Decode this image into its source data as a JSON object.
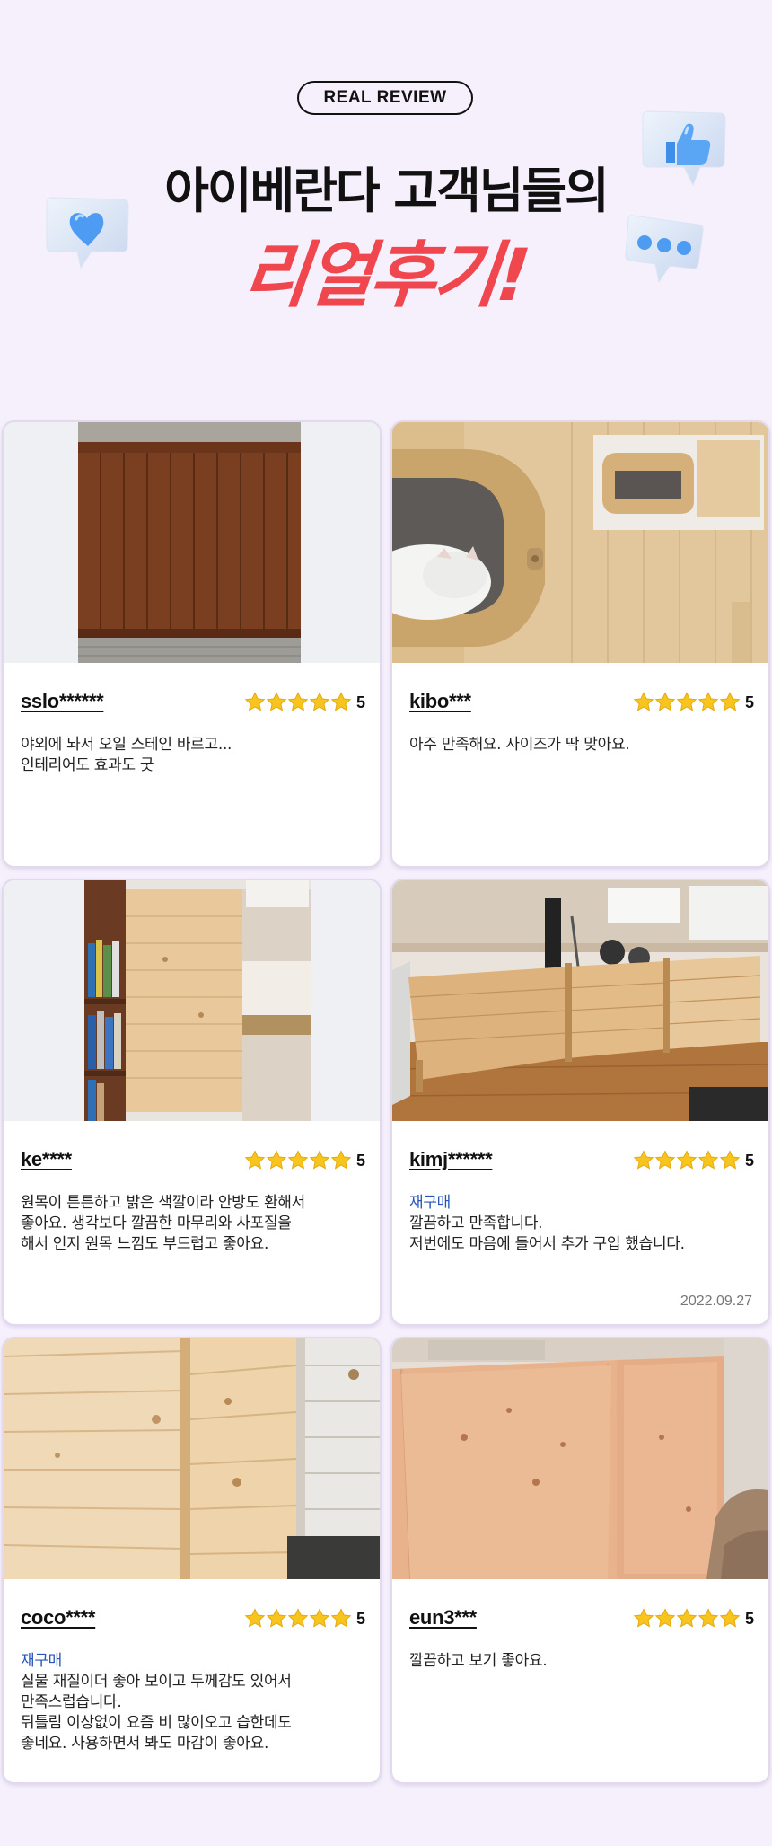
{
  "header": {
    "pill": "REAL REVIEW",
    "title_line1": "아이베란다 고객님들의",
    "title_line2": "리얼후기!",
    "decor_icons": [
      "heart-icon",
      "thumbs-up-icon",
      "chat-dots-icon"
    ]
  },
  "colors": {
    "background": "#f6f0fd",
    "accent_red": "#f0464e",
    "rebuy_blue": "#2a55b8",
    "star": "#f7c51e",
    "icon_blue": "#5aa6f5"
  },
  "reviews": [
    {
      "name": "sslo******",
      "rating": "5",
      "rebuy": "",
      "lines": [
        "야외에 놔서 오일 스테인 바르고...",
        "인테리어도 효과도 굿"
      ],
      "date": ""
    },
    {
      "name": "kibo***",
      "rating": "5",
      "rebuy": "",
      "lines": [
        "아주 만족해요. 사이즈가 딱 맞아요."
      ],
      "date": ""
    },
    {
      "name": "ke****",
      "rating": "5",
      "rebuy": "",
      "lines": [
        "원목이 튼튼하고 밝은 색깔이라 안방도 환해서",
        "좋아요. 생각보다 깔끔한 마무리와 사포질을",
        "해서 인지 원목 느낌도 부드럽고 좋아요."
      ],
      "date": ""
    },
    {
      "name": "kimj******",
      "rating": "5",
      "rebuy": "재구매",
      "lines": [
        "깔끔하고 만족합니다.",
        "저번에도 마음에 들어서 추가 구입 했습니다."
      ],
      "date": "2022.09.27"
    },
    {
      "name": "coco****",
      "rating": "5",
      "rebuy": "재구매",
      "lines": [
        "실물 재질이더 좋아 보이고 두께감도 있어서",
        "만족스럽습니다.",
        "뒤틀림 이상없이 요즘 비 많이오고 습한데도",
        "좋네요. 사용하면서 봐도 마감이 좋아요."
      ],
      "date": ""
    },
    {
      "name": "eun3***",
      "rating": "5",
      "rebuy": "",
      "lines": [
        "깔끔하고 보기 좋아요."
      ],
      "date": ""
    }
  ]
}
